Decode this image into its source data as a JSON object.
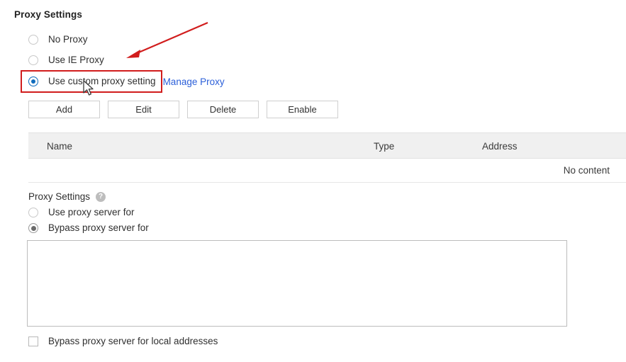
{
  "section": {
    "title": "Proxy Settings"
  },
  "proxy_mode": {
    "options": [
      {
        "label": "No Proxy",
        "selected": false
      },
      {
        "label": "Use IE Proxy",
        "selected": false
      },
      {
        "label": "Use custom proxy setting",
        "selected": true
      }
    ],
    "manage_link": "Manage Proxy"
  },
  "toolbar": {
    "add_label": "Add",
    "edit_label": "Edit",
    "delete_label": "Delete",
    "enable_label": "Enable"
  },
  "table": {
    "columns": [
      "Name",
      "Type",
      "Address"
    ],
    "rows": [],
    "empty_text": "No content"
  },
  "lower": {
    "title": "Proxy Settings",
    "help_glyph": "?",
    "options": [
      {
        "label": "Use proxy server for",
        "selected": false
      },
      {
        "label": "Bypass proxy server for",
        "selected": true
      }
    ],
    "bypass_list_value": "",
    "bypass_list_placeholder": "",
    "local_checkbox_label": "Bypass proxy server for local addresses",
    "local_checkbox_checked": false
  },
  "annotations": {
    "highlight_color": "#d11d1d",
    "arrow_color": "#d11d1d",
    "link_color": "#2b5fd9",
    "accent_color": "#0f6cbd"
  }
}
